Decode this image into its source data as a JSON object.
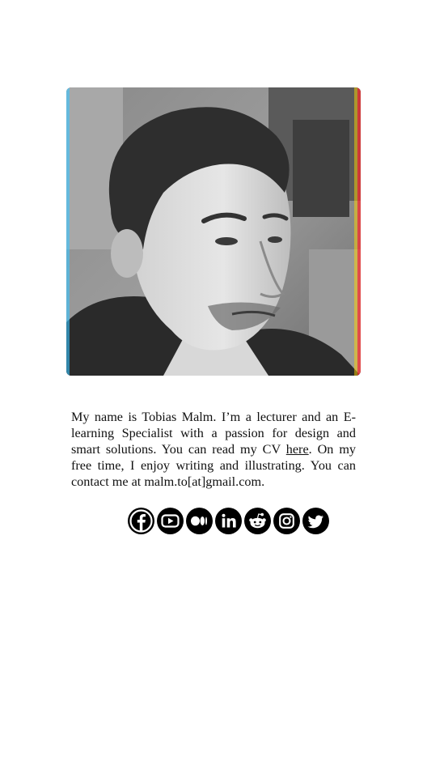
{
  "profile": {
    "photo_icon": "portrait-photo",
    "bio_before_link": "My name is Tobias Malm. I’m a lecturer and an E-learning Specialist with a passion for design and smart solutions. You can read my CV ",
    "cv_link_label": "here",
    "bio_after_link": ". On my free time, I enjoy writing and illustrating. You can contact me at malm.to[at]gmail.com."
  },
  "socials": [
    {
      "name": "facebook",
      "icon": "facebook-icon"
    },
    {
      "name": "youtube",
      "icon": "youtube-icon"
    },
    {
      "name": "medium",
      "icon": "medium-icon"
    },
    {
      "name": "linkedin",
      "icon": "linkedin-icon"
    },
    {
      "name": "reddit",
      "icon": "reddit-icon"
    },
    {
      "name": "instagram",
      "icon": "instagram-icon"
    },
    {
      "name": "twitter",
      "icon": "twitter-icon"
    }
  ],
  "colors": {
    "background": "#ffffff",
    "text": "#111111",
    "icon_circle": "#000000",
    "icon_glyph": "#ffffff"
  }
}
